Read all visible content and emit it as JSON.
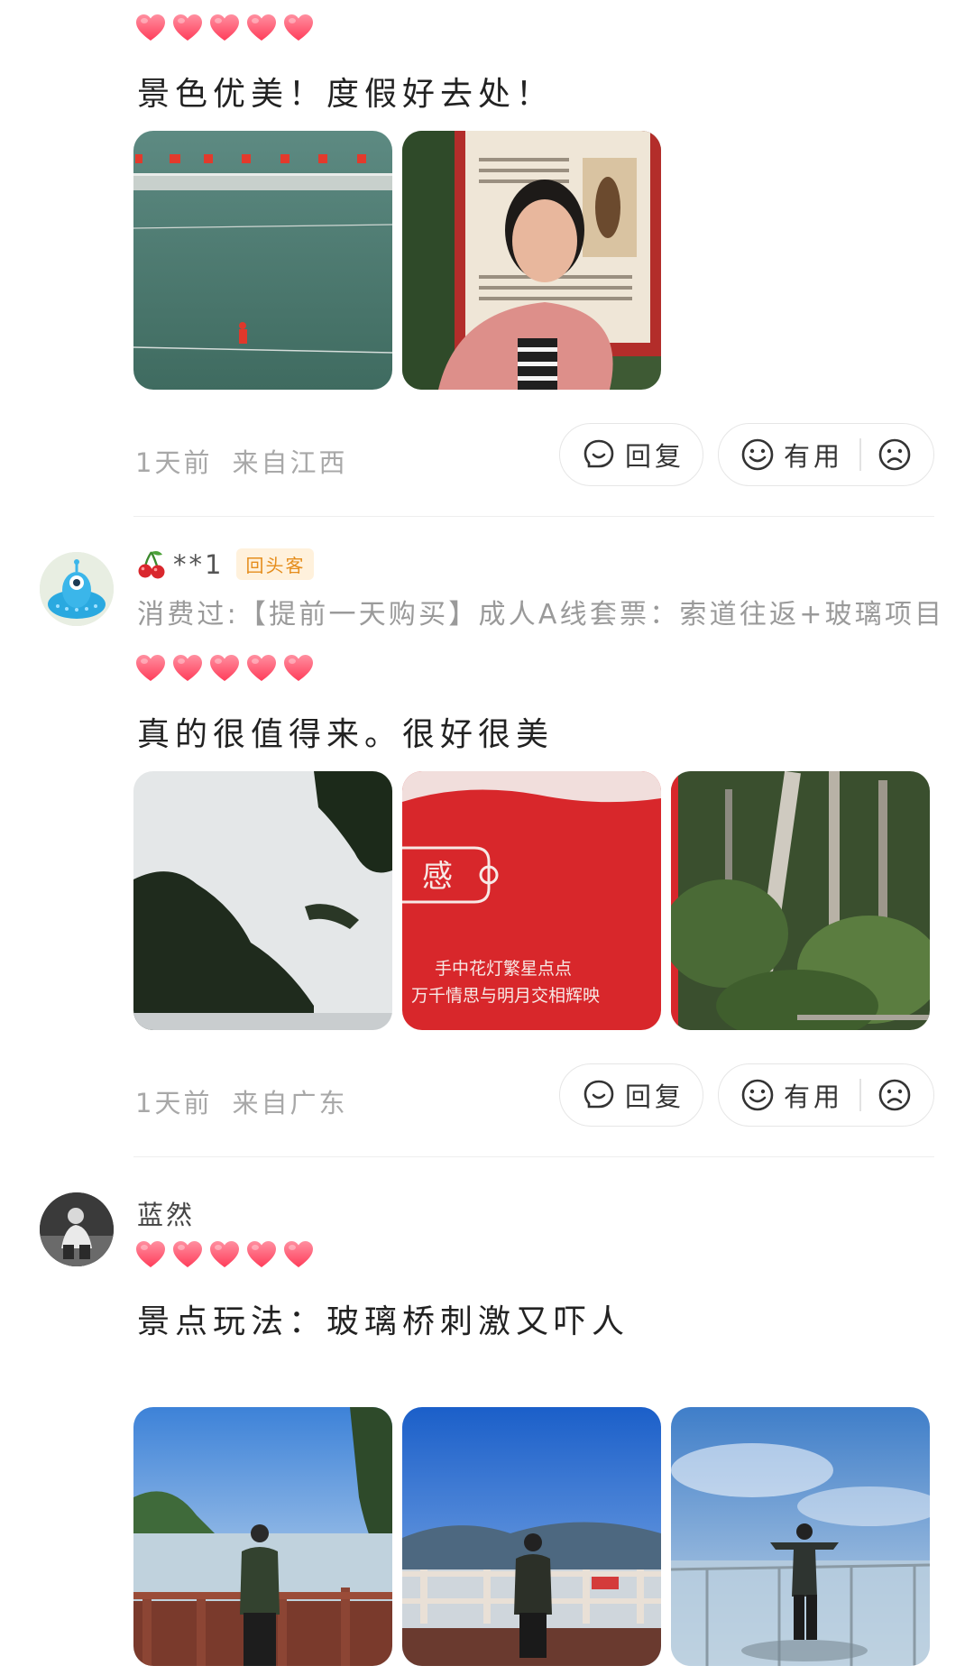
{
  "reviews": [
    {
      "rating": 5,
      "text": "景色优美！度假好去处！",
      "photos": [
        "glass-bridge-tightrope-photo",
        "selfie-by-sign-photo"
      ],
      "time": "1天前",
      "location": "来自江西",
      "reply_label": "回复",
      "useful_label": "有用"
    },
    {
      "username": "**1",
      "badge": "回头客",
      "purchase": "消费过:【提前一天购买】成人A线套票：索道往返+玻璃项目",
      "rating": 5,
      "text": "真的很值得来。很好很美",
      "photos": [
        "trees-sky-photo",
        "red-banner-photo",
        "forest-photo"
      ],
      "time": "1天前",
      "location": "来自广东",
      "reply_label": "回复",
      "useful_label": "有用"
    },
    {
      "username": "蓝然",
      "rating": 5,
      "text": "景点玩法：玻璃桥刺激又吓人",
      "photos": [
        "lake-railing-photo",
        "mountain-view-photo",
        "glass-platform-photo"
      ]
    }
  ],
  "banner_text": {
    "line1": "手中花灯繁星点点",
    "line2": "万千情思与明月交相辉映",
    "fragment": "感"
  },
  "colors": {
    "heart": "#ff3d5a",
    "heart_light": "#ff8fa0",
    "meta": "#a8a8a8",
    "badge_bg": "#fff1dc",
    "badge_text": "#e58d1c"
  }
}
